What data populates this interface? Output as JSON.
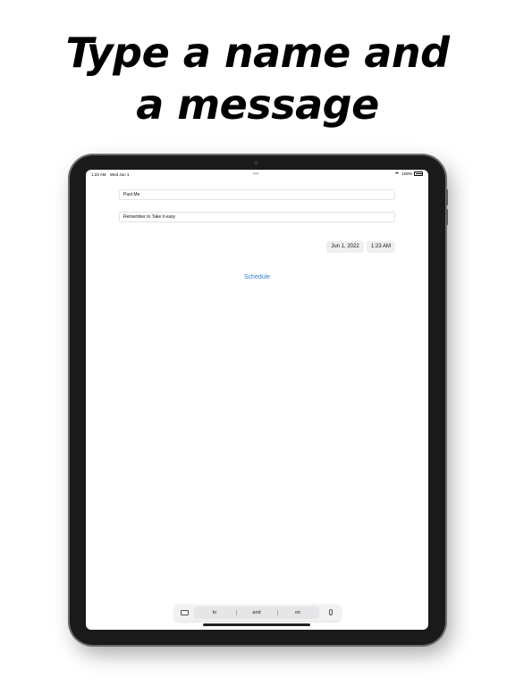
{
  "headline": {
    "line1": "Type a name and",
    "line2": "a message"
  },
  "status_bar": {
    "time": "1:23 AM",
    "date": "Wed Jun 1",
    "battery": "100%"
  },
  "form": {
    "name_value": "Past Me",
    "message_value": "Remember to Take it easy",
    "date_value": "Jun 1, 2022",
    "time_value": "1:23 AM",
    "schedule_label": "Schedule"
  },
  "keyboard_suggestions": [
    "to",
    "and",
    "on"
  ],
  "colors": {
    "accent": "#2f7fd4",
    "pill_bg": "#efeff0",
    "device_bezel": "#1a1a1a"
  },
  "icons": [
    "keyboard-icon",
    "microphone-icon",
    "wifi-icon",
    "battery-icon"
  ]
}
